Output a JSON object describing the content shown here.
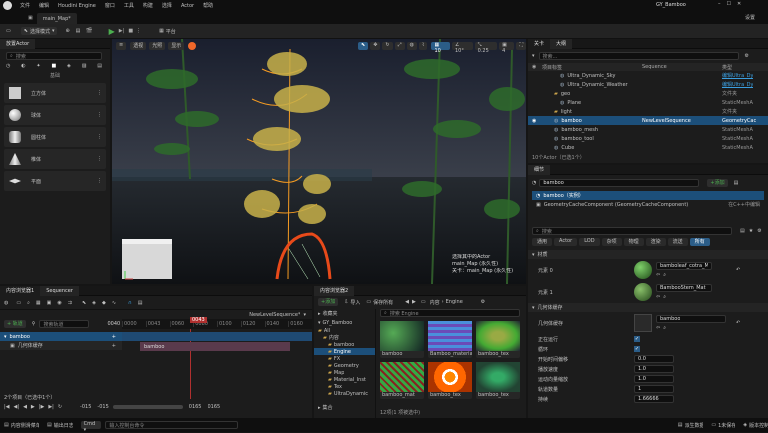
{
  "colors": {
    "accent": "#2b7fd4",
    "selection": "#1c4f7a",
    "orange": "#f59b22",
    "green": "#4caf50",
    "red": "#b0302f",
    "bg": "#1c1c1c"
  },
  "menu": {
    "app_logo": "unreal-logo",
    "items": [
      "文件",
      "编辑",
      "Houdini Engine",
      "窗口",
      "工具",
      "构建",
      "选择",
      "Actor",
      "帮助"
    ],
    "project": "GY_Bamboo",
    "settings": "设置"
  },
  "doc_tab": {
    "label": "main_Map*"
  },
  "toolbar": {
    "save_icon": "save-icon",
    "mode": "选择模式",
    "platform": "平台"
  },
  "place_panel": {
    "title": "放置Actor",
    "search_placeholder": "搜索",
    "category_label": "基础",
    "items": [
      {
        "icon": "cube-icon",
        "label": "立方体"
      },
      {
        "icon": "sphere-icon",
        "label": "球体"
      },
      {
        "icon": "cylinder-icon",
        "label": "圆柱体"
      },
      {
        "icon": "cone-icon",
        "label": "椎体"
      },
      {
        "icon": "plane-icon",
        "label": "平面"
      }
    ]
  },
  "viewport": {
    "view_mode": "透视",
    "lit": "光照",
    "show": "显示",
    "snap_angle": "10°",
    "snap_grid": "10",
    "snap_scale": "0.25",
    "cam_speed": "4",
    "status_line1": "选择其中的Actor",
    "status_line2": "main_Map (永久性)",
    "status_line3": "关卡：main_Map (永久性)"
  },
  "outliner": {
    "tab1": "关卡",
    "tab2": "大纲",
    "search_placeholder": "搜索...",
    "col_label": "项目标签",
    "col_type": "类型",
    "rows": [
      {
        "label": "Ultra_Dynamic_Sky",
        "seq": "",
        "type": "编辑Ultra_Dy",
        "link": true,
        "selected": false,
        "indent": 3
      },
      {
        "label": "Ultra_Dynamic_Weather",
        "seq": "",
        "type": "编辑Ultra_Dy",
        "link": true,
        "selected": false,
        "indent": 3
      },
      {
        "label": "geo",
        "seq": "",
        "type": "文件夹",
        "link": false,
        "selected": false,
        "indent": 2
      },
      {
        "label": "Plane",
        "seq": "",
        "type": "StaticMeshA",
        "link": false,
        "selected": false,
        "indent": 3
      },
      {
        "label": "light",
        "seq": "",
        "type": "文件夹",
        "link": false,
        "selected": false,
        "indent": 2
      },
      {
        "label": "bamboo",
        "seq": "NewLevelSequence",
        "type": "GeometryCac",
        "link": false,
        "selected": true,
        "indent": 2
      },
      {
        "label": "bamboo_mesh",
        "seq": "",
        "type": "StaticMeshA",
        "link": false,
        "selected": false,
        "indent": 2
      },
      {
        "label": "bamboo_tool",
        "seq": "",
        "type": "StaticMeshA",
        "link": false,
        "selected": false,
        "indent": 2
      },
      {
        "label": "Cube",
        "seq": "",
        "type": "StaticMeshA",
        "link": false,
        "selected": false,
        "indent": 2
      }
    ],
    "seq_header": "Sequence",
    "footer": "10个Actor（已选1个）"
  },
  "details": {
    "tab": "细节",
    "actor_name": "bamboo",
    "add_label": "+添加",
    "root_label": "bamboo（实例）",
    "component": "GeometryCacheComponent (GeometryCacheComponent)",
    "component_hint": "在C++中编辑",
    "search_placeholder": "搜索",
    "categories": [
      "通用",
      "Actor",
      "LOD",
      "杂项",
      "物理",
      "渲染",
      "流送",
      "所有"
    ],
    "active_category": "所有",
    "section_material": "材质",
    "elem0_label": "元素 0",
    "elem0_value": "bamboleaf_cotra_Mat",
    "elem1_label": "元素 1",
    "elem1_value": "BambooStem_Mat",
    "section_geo": "几何体缓存",
    "geo_label": "几何体缓存",
    "geo_value": "bamboo",
    "props": [
      {
        "label": "正在运行",
        "value": "",
        "check": true
      },
      {
        "label": "循环",
        "value": "",
        "check": true
      },
      {
        "label": "开始时间偏移",
        "value": "0.0",
        "check": false
      },
      {
        "label": "播放速度",
        "value": "1.0",
        "check": false
      },
      {
        "label": "运动向量缩放",
        "value": "1.0",
        "check": false
      },
      {
        "label": "轨道数量",
        "value": "1",
        "check": false
      },
      {
        "label": "持续",
        "value": "1.66666",
        "check": false
      }
    ]
  },
  "sequencer": {
    "tab1": "内容浏览器1",
    "tab2": "Sequencer",
    "add_track": "+ 轨道",
    "search_placeholder": "搜索轨道",
    "frame_current": "0043",
    "frame_end": "0040",
    "seq_name": "NewLevelSequence*",
    "tracks": [
      {
        "label": "bamboo",
        "selected": true
      },
      {
        "label": "几何体缓存",
        "selected": false
      }
    ],
    "clip_label": "bamboo",
    "footer": "2个项目（已选中1个）",
    "time_left": "-015",
    "time_left2": "-015",
    "time_right": "0165",
    "time_right2": "0165",
    "ruler": [
      "0000",
      "0043",
      "0060",
      "0080",
      "0100",
      "0120",
      "0140",
      "0160"
    ]
  },
  "content": {
    "tab": "内容浏览器2",
    "add": "+添加",
    "import": "导入",
    "save_all": "保存所有",
    "breadcrumb": [
      "内容",
      "Engine"
    ],
    "search_placeholder": "搜索 Engine",
    "fav_label": "收藏夹",
    "project_label": "GY_Bamboo",
    "tree": [
      {
        "label": "All",
        "indent": 0
      },
      {
        "label": "内容",
        "indent": 1
      },
      {
        "label": "bamboo",
        "indent": 2
      },
      {
        "label": "Engine",
        "indent": 2,
        "selected": true
      },
      {
        "label": "FX",
        "indent": 2
      },
      {
        "label": "Geometry",
        "indent": 2
      },
      {
        "label": "Map",
        "indent": 2
      },
      {
        "label": "Material_Inst",
        "indent": 2
      },
      {
        "label": "Tex",
        "indent": 2
      },
      {
        "label": "UltraDynamic",
        "indent": 2
      }
    ],
    "collections": "集合",
    "assets": [
      {
        "label": "bamboo",
        "kind": "leaf"
      },
      {
        "label": "Bamboo_material",
        "kind": "stripe"
      },
      {
        "label": "bamboo_tex",
        "kind": "terrain"
      },
      {
        "label": "bamboo_mat",
        "kind": "mesh"
      },
      {
        "label": "bamboo_tex",
        "kind": "swirl"
      },
      {
        "label": "bamboo_tex",
        "kind": "grass"
      }
    ],
    "footer": "12项(1 项被选中)"
  },
  "statusbar": {
    "drawer": "内容侧滑菜单",
    "output": "输出日志",
    "cmd": "Cmd",
    "console_placeholder": "输入控制台命令",
    "unsaved": "1未保存",
    "revision": "版本控制",
    "derived": "派生数据"
  }
}
